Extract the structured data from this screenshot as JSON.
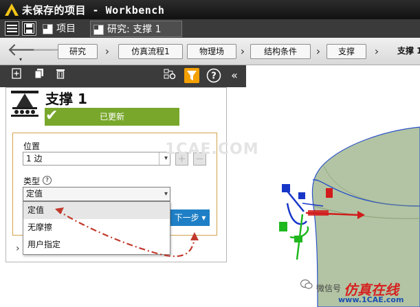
{
  "window": {
    "title": "未保存的项目 - Workbench"
  },
  "tabs": [
    {
      "label": "项目"
    },
    {
      "label": "研究: 支撑 1"
    }
  ],
  "breadcrumb": {
    "items": [
      "研究",
      "仿真流程1",
      "物理场",
      "结构条件",
      "支撑",
      "支撑 1"
    ],
    "separator": "›"
  },
  "panel": {
    "title": "支撑 1",
    "status": "已更新",
    "location_label": "位置",
    "location_value": "1 边",
    "type_label": "类型",
    "type_selected": "定值",
    "type_options": [
      "定值",
      "无摩擦",
      "用户指定"
    ],
    "next_button": "下一步"
  },
  "glyphs": {
    "back": "🡐",
    "forward": "🡒",
    "add": "+",
    "remove": "−",
    "help": "?",
    "collapse": "«",
    "expand": "›",
    "dropdown": "▾",
    "checkmark": "✔"
  },
  "colors": {
    "status_green": "#78a72c",
    "next_blue": "#1f7fc6",
    "filter_orange": "#f4a000",
    "annotation_red": "#c0392b",
    "part_surface": "#b2c4a3"
  },
  "watermarks": {
    "center": "1CAE.COM",
    "wechat": "微信号",
    "site_name": "仿真在线",
    "site_url": "www.1CAE.com"
  }
}
